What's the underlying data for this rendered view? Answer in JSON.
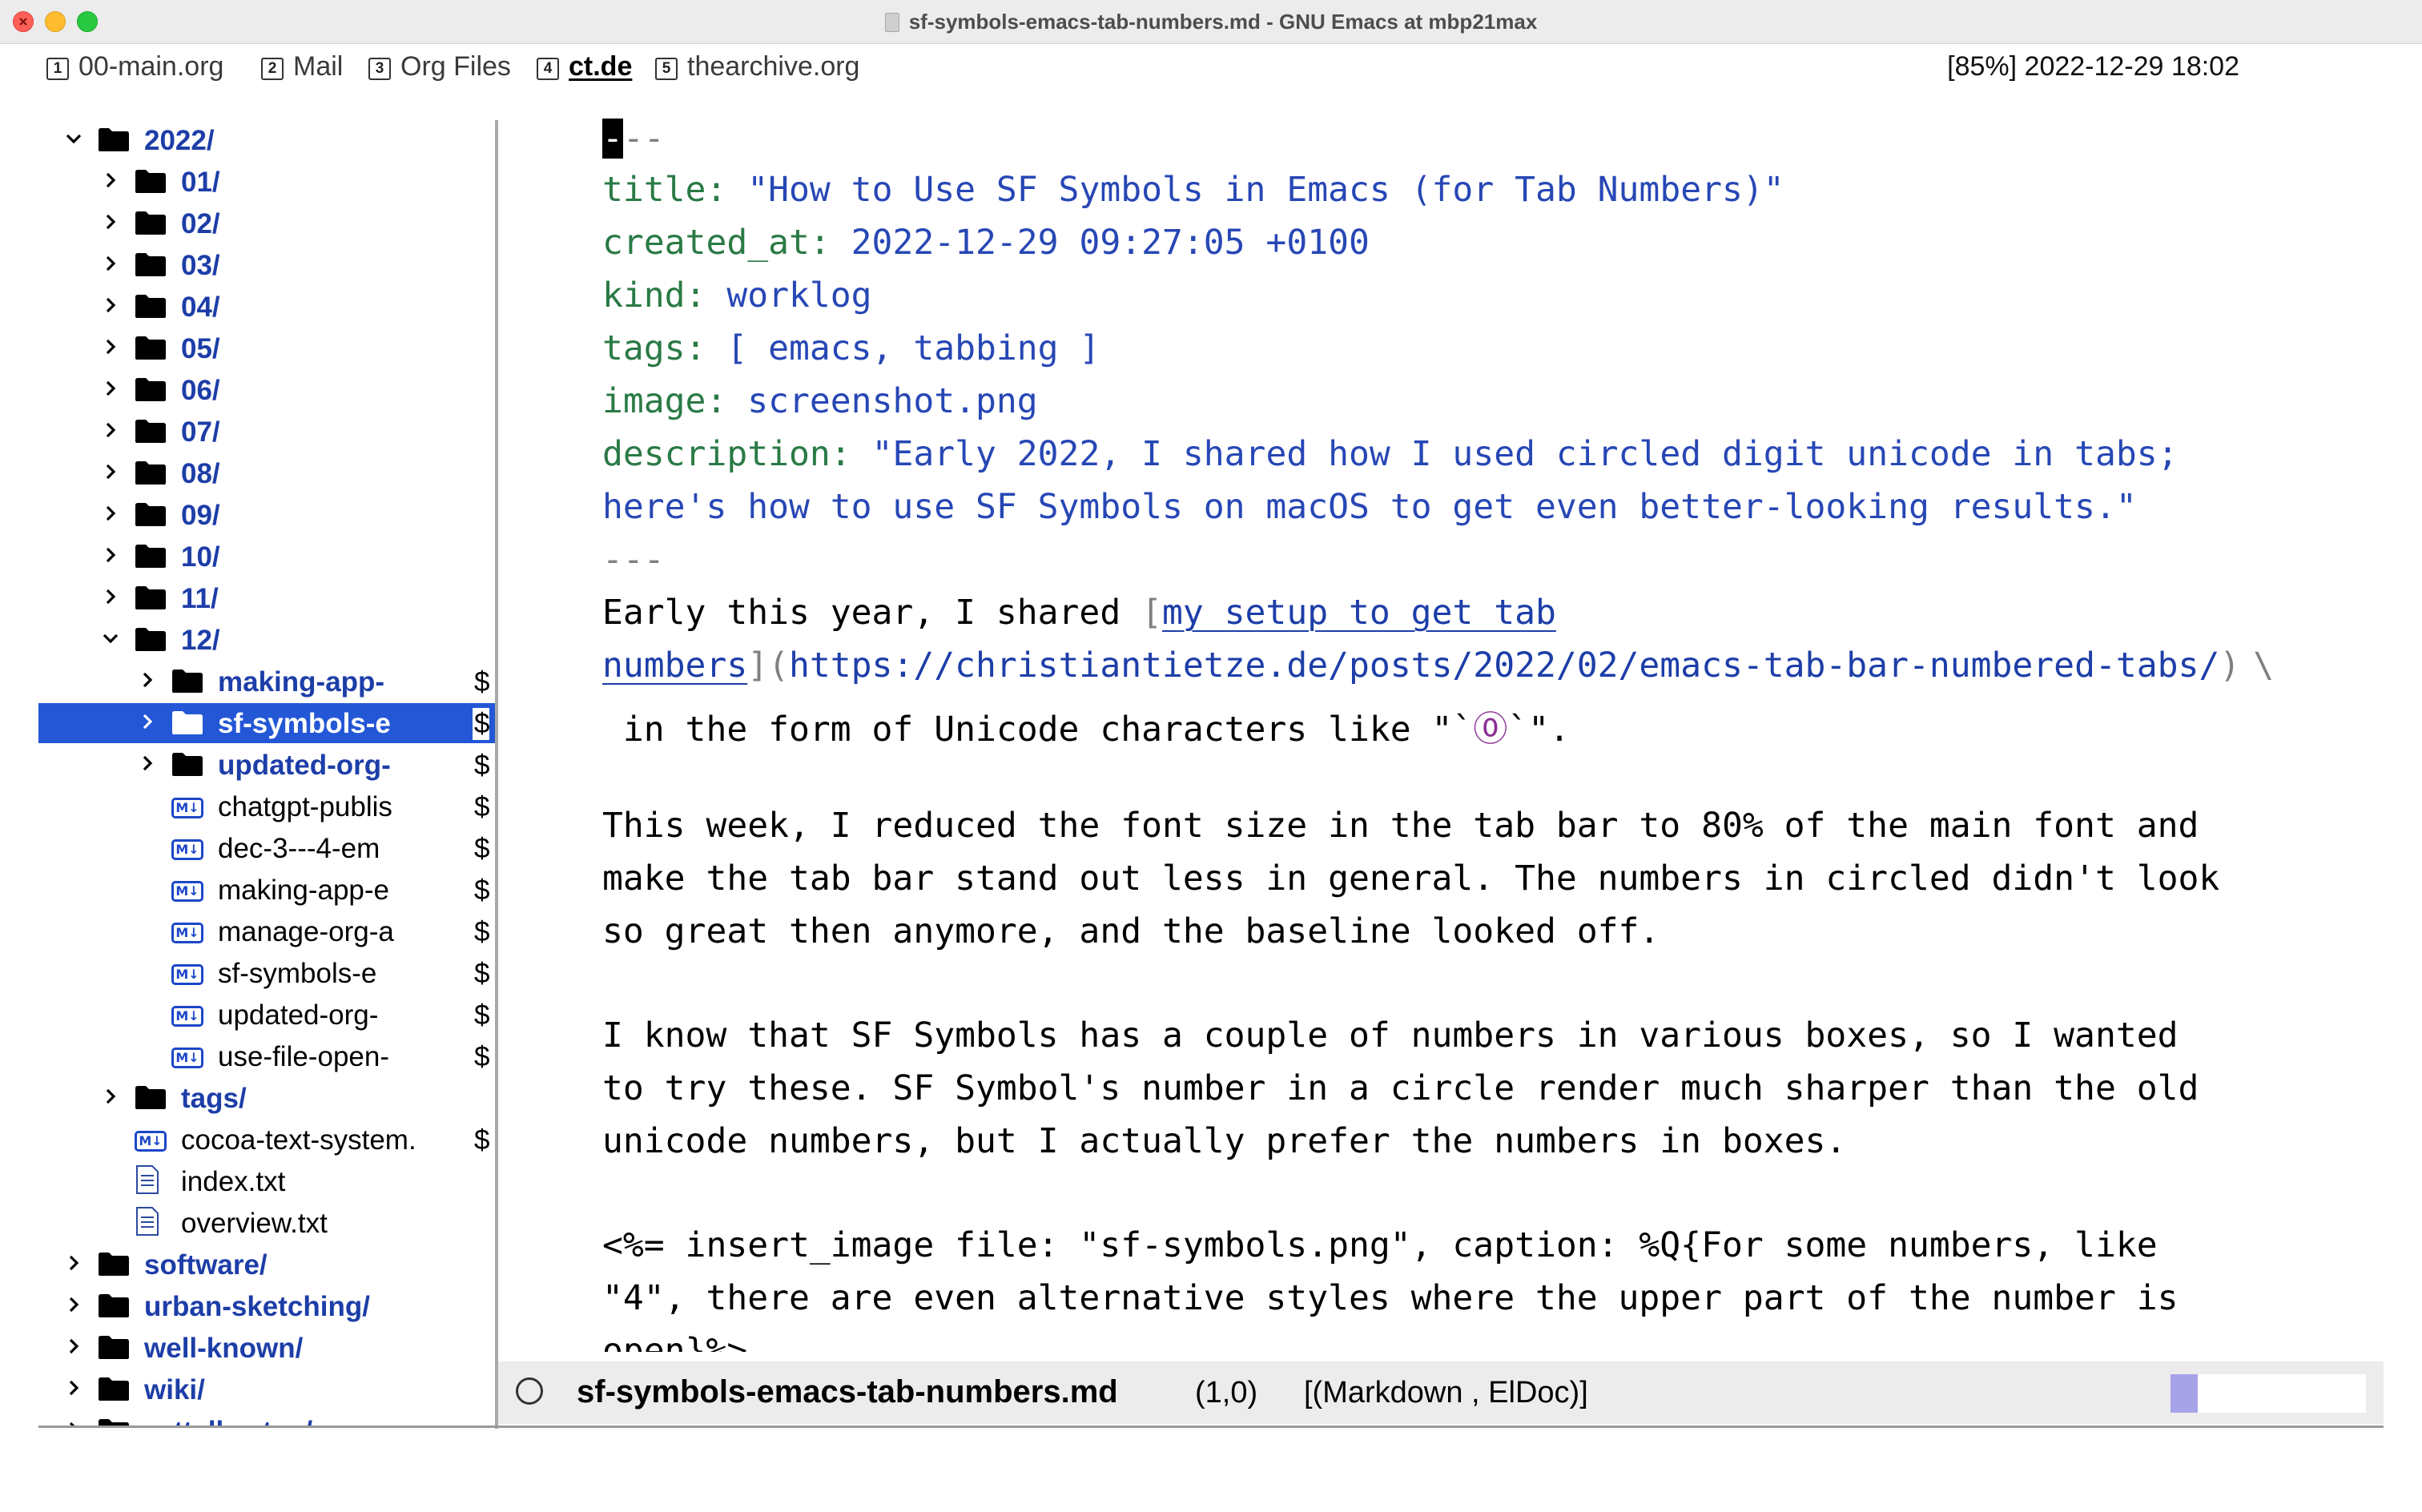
{
  "window": {
    "title": "sf-symbols-emacs-tab-numbers.md - GNU Emacs at mbp21max"
  },
  "tabs": [
    {
      "num": "1",
      "label": "00-main.org",
      "active": false
    },
    {
      "num": "2",
      "label": "Mail",
      "active": false
    },
    {
      "num": "3",
      "label": "Org Files",
      "active": false
    },
    {
      "num": "4",
      "label": "ct.de",
      "active": true
    },
    {
      "num": "5",
      "label": "thearchive.org",
      "active": false
    }
  ],
  "clock": "[85%] 2022-12-29 18:02",
  "sidebar": {
    "rows": [
      {
        "label": "2022/",
        "type": "dir",
        "expanded": true,
        "depth": 1
      },
      {
        "label": "01/",
        "type": "dir",
        "expanded": false,
        "depth": 2
      },
      {
        "label": "02/",
        "type": "dir",
        "expanded": false,
        "depth": 2
      },
      {
        "label": "03/",
        "type": "dir",
        "expanded": false,
        "depth": 2
      },
      {
        "label": "04/",
        "type": "dir",
        "expanded": false,
        "depth": 2
      },
      {
        "label": "05/",
        "type": "dir",
        "expanded": false,
        "depth": 2
      },
      {
        "label": "06/",
        "type": "dir",
        "expanded": false,
        "depth": 2
      },
      {
        "label": "07/",
        "type": "dir",
        "expanded": false,
        "depth": 2
      },
      {
        "label": "08/",
        "type": "dir",
        "expanded": false,
        "depth": 2
      },
      {
        "label": "09/",
        "type": "dir",
        "expanded": false,
        "depth": 2
      },
      {
        "label": "10/",
        "type": "dir",
        "expanded": false,
        "depth": 2
      },
      {
        "label": "11/",
        "type": "dir",
        "expanded": false,
        "depth": 2
      },
      {
        "label": "12/",
        "type": "dir",
        "expanded": true,
        "depth": 2
      },
      {
        "label": "making-app-",
        "type": "dir",
        "expanded": false,
        "depth": 3,
        "trunc": "$"
      },
      {
        "label": "sf-symbols-e",
        "type": "dir",
        "expanded": false,
        "depth": 3,
        "trunc": "$",
        "selected": true
      },
      {
        "label": "updated-org-",
        "type": "dir",
        "expanded": false,
        "depth": 3,
        "trunc": "$"
      },
      {
        "label": "chatgpt-publis",
        "type": "md",
        "depth": 3,
        "trunc": "$"
      },
      {
        "label": "dec-3---4-em",
        "type": "md",
        "depth": 3,
        "trunc": "$"
      },
      {
        "label": "making-app-e",
        "type": "md",
        "depth": 3,
        "trunc": "$"
      },
      {
        "label": "manage-org-a",
        "type": "md",
        "depth": 3,
        "trunc": "$"
      },
      {
        "label": "sf-symbols-e",
        "type": "md",
        "depth": 3,
        "trunc": "$"
      },
      {
        "label": "updated-org-",
        "type": "md",
        "depth": 3,
        "trunc": "$"
      },
      {
        "label": "use-file-open-",
        "type": "md",
        "depth": 3,
        "trunc": "$"
      },
      {
        "label": "tags/",
        "type": "dir",
        "expanded": false,
        "depth": 2
      },
      {
        "label": "cocoa-text-system.",
        "type": "md",
        "depth": 2,
        "trunc": "$"
      },
      {
        "label": "index.txt",
        "type": "txt",
        "depth": 2
      },
      {
        "label": "overview.txt",
        "type": "txt",
        "depth": 2
      },
      {
        "label": "software/",
        "type": "dir",
        "expanded": false,
        "depth": 1
      },
      {
        "label": "urban-sketching/",
        "type": "dir",
        "expanded": false,
        "depth": 1
      },
      {
        "label": "well-known/",
        "type": "dir",
        "expanded": false,
        "depth": 1
      },
      {
        "label": "wiki/",
        "type": "dir",
        "expanded": false,
        "depth": 1
      },
      {
        "label": "zettelkasten/",
        "type": "dir",
        "expanded": false,
        "depth": 1
      }
    ]
  },
  "editor": {
    "fm_open_cursor": "-",
    "fm_open_rest": "--",
    "title_key": "title:",
    "title_val": "\"How to Use SF Symbols in Emacs (for Tab Numbers)\"",
    "created_key": "created_at:",
    "created_val": "2022-12-29 09:27:05 +0100",
    "kind_key": "kind:",
    "kind_val": "worklog",
    "tags_key": "tags:",
    "tags_val": "[ emacs, tabbing ]",
    "image_key": "image:",
    "image_val": "screenshot.png",
    "desc_key": "description:",
    "desc_val1": "\"Early 2022, I shared how I used circled digit unicode in tabs;",
    "desc_val2": "here's how to use SF Symbols on macOS to get even better-looking results.\"",
    "fm_close": "---",
    "p1_a": "Early this year, I shared ",
    "p1_bracket_open": "[",
    "p1_link1": "my setup to get tab",
    "p1_link2": "numbers",
    "p1_bracket_close": "](",
    "p1_url": "https://christiantietze.de/posts/2022/02/emacs-tab-bar-numbered-tabs/",
    "p1_paren_close": ")",
    "p1_backslash": "\\",
    "p1_line3_a": " in the form of Unicode characters like \"`",
    "p1_circled": "⓪",
    "p1_line3_b": "`\".",
    "p2_l1": "This week, I reduced the font size in the tab bar to 80% of the main font and",
    "p2_l2": "make the tab bar stand out less in general. The numbers in circled didn't look",
    "p2_l3": "so great then anymore, and the baseline looked off.",
    "p3_l1": "I know that SF Symbols has a couple of numbers in various boxes, so I wanted",
    "p3_l2": "to try these. SF Symbol's number in a circle render much sharper than the old",
    "p3_l3": "unicode numbers, but I actually prefer the numbers in boxes.",
    "p4_l1": "<%= insert_image file: \"sf-symbols.png\", caption: %Q{For some numbers, like",
    "p4_l2": "\"4\", there are even alternative styles where the upper part of the number is",
    "p4_l3": "open}%>"
  },
  "modeline": {
    "buffer_name": "sf-symbols-emacs-tab-numbers.md",
    "position": "(1,0)",
    "modes": "[(Markdown , ElDoc)]",
    "scroll_fraction": 0.14
  },
  "colors": {
    "directory": "#1d3ea8",
    "selection": "#2357d6",
    "frontmatter_key": "#2a7a45",
    "frontmatter_value": "#2747b5"
  }
}
